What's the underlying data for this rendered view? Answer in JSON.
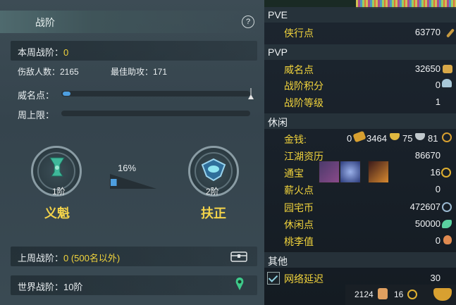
{
  "left": {
    "title": "战阶",
    "help": "?",
    "week_rank_label": "本周战阶：",
    "week_rank_value": "0",
    "kills_label": "伤敌人数：2165",
    "assist_label": "最佳助攻：171",
    "fame_label": "威名点：",
    "fame_progress": 0.04,
    "week_cap_label": "周上限：",
    "week_cap_progress": 0,
    "current_rank": {
      "level": "1阶",
      "name": "义魁"
    },
    "next_rank": {
      "level": "2阶",
      "name": "扶正"
    },
    "progress_pct": "16%",
    "progress_value": 0.16,
    "last_week_label": "上周战阶：",
    "last_week_value": "0 (500名以外)",
    "world_rank_label": "世界战阶：10阶"
  },
  "right": {
    "pve_header": "PVE",
    "pve_items": [
      {
        "label": "侠行点",
        "value": "63770"
      }
    ],
    "pvp_header": "PVP",
    "pvp_items": [
      {
        "label": "威名点",
        "value": "32650"
      },
      {
        "label": "战阶积分",
        "value": "0"
      },
      {
        "label": "战阶等级",
        "value": "1"
      }
    ],
    "leisure_header": "休闲",
    "money": {
      "label": "金钱:",
      "v0": "0",
      "v1": "3464",
      "v2": "75",
      "v3": "81"
    },
    "leisure_items": [
      {
        "label": "江湖资历",
        "value": "86670"
      },
      {
        "label": "通宝",
        "value": "16"
      },
      {
        "label": "薪火点",
        "value": "0"
      },
      {
        "label": "园宅币",
        "value": "472607"
      },
      {
        "label": "休闲点",
        "value": "50000"
      },
      {
        "label": "桃李值",
        "value": "0"
      }
    ],
    "other_header": "其他",
    "network_label": "网络延迟",
    "network_value": "30",
    "bottom_v1": "2124",
    "bottom_v2": "16"
  },
  "colors": {
    "accent_yellow": "#f2d43c",
    "bar_blue": "#4e9fe0"
  }
}
